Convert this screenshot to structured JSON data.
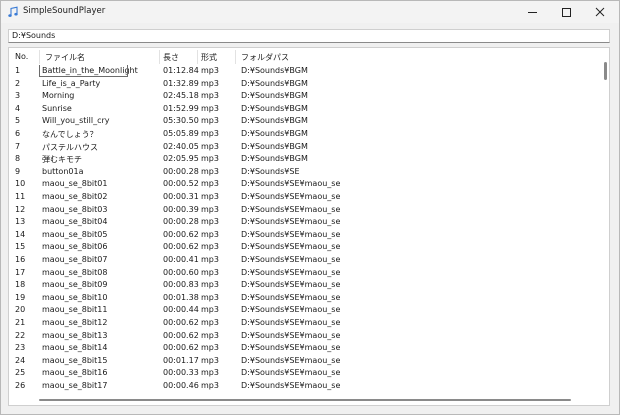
{
  "window": {
    "title": "SimpleSoundPlayer",
    "icon": "music-note-icon"
  },
  "path_bar": {
    "value": "D:¥Sounds"
  },
  "columns": [
    "No.",
    "ファイル名",
    "長さ",
    "形式",
    "フォルダパス"
  ],
  "rows": [
    {
      "no": "1",
      "name": "Battle_in_the_Moonlight",
      "length": "01:12.84",
      "format": "mp3",
      "folder": "D:¥Sounds¥BGM"
    },
    {
      "no": "2",
      "name": "Life_is_a_Party",
      "length": "01:32.89",
      "format": "mp3",
      "folder": "D:¥Sounds¥BGM"
    },
    {
      "no": "3",
      "name": "Morning",
      "length": "02:45.18",
      "format": "mp3",
      "folder": "D:¥Sounds¥BGM"
    },
    {
      "no": "4",
      "name": "Sunrise",
      "length": "01:52.99",
      "format": "mp3",
      "folder": "D:¥Sounds¥BGM"
    },
    {
      "no": "5",
      "name": "Will_you_still_cry",
      "length": "05:30.50",
      "format": "mp3",
      "folder": "D:¥Sounds¥BGM"
    },
    {
      "no": "6",
      "name": "なんでしょう？",
      "length": "05:05.89",
      "format": "mp3",
      "folder": "D:¥Sounds¥BGM"
    },
    {
      "no": "7",
      "name": "パステルハウス",
      "length": "02:40.05",
      "format": "mp3",
      "folder": "D:¥Sounds¥BGM"
    },
    {
      "no": "8",
      "name": "弾むキモチ",
      "length": "02:05.95",
      "format": "mp3",
      "folder": "D:¥Sounds¥BGM"
    },
    {
      "no": "9",
      "name": "button01a",
      "length": "00:00.28",
      "format": "mp3",
      "folder": "D:¥Sounds¥SE"
    },
    {
      "no": "10",
      "name": "maou_se_8bit01",
      "length": "00:00.52",
      "format": "mp3",
      "folder": "D:¥Sounds¥SE¥maou_se"
    },
    {
      "no": "11",
      "name": "maou_se_8bit02",
      "length": "00:00.31",
      "format": "mp3",
      "folder": "D:¥Sounds¥SE¥maou_se"
    },
    {
      "no": "12",
      "name": "maou_se_8bit03",
      "length": "00:00.39",
      "format": "mp3",
      "folder": "D:¥Sounds¥SE¥maou_se"
    },
    {
      "no": "13",
      "name": "maou_se_8bit04",
      "length": "00:00.28",
      "format": "mp3",
      "folder": "D:¥Sounds¥SE¥maou_se"
    },
    {
      "no": "14",
      "name": "maou_se_8bit05",
      "length": "00:00.62",
      "format": "mp3",
      "folder": "D:¥Sounds¥SE¥maou_se"
    },
    {
      "no": "15",
      "name": "maou_se_8bit06",
      "length": "00:00.62",
      "format": "mp3",
      "folder": "D:¥Sounds¥SE¥maou_se"
    },
    {
      "no": "16",
      "name": "maou_se_8bit07",
      "length": "00:00.41",
      "format": "mp3",
      "folder": "D:¥Sounds¥SE¥maou_se"
    },
    {
      "no": "17",
      "name": "maou_se_8bit08",
      "length": "00:00.60",
      "format": "mp3",
      "folder": "D:¥Sounds¥SE¥maou_se"
    },
    {
      "no": "18",
      "name": "maou_se_8bit09",
      "length": "00:00.83",
      "format": "mp3",
      "folder": "D:¥Sounds¥SE¥maou_se"
    },
    {
      "no": "19",
      "name": "maou_se_8bit10",
      "length": "00:01.38",
      "format": "mp3",
      "folder": "D:¥Sounds¥SE¥maou_se"
    },
    {
      "no": "20",
      "name": "maou_se_8bit11",
      "length": "00:00.44",
      "format": "mp3",
      "folder": "D:¥Sounds¥SE¥maou_se"
    },
    {
      "no": "21",
      "name": "maou_se_8bit12",
      "length": "00:00.62",
      "format": "mp3",
      "folder": "D:¥Sounds¥SE¥maou_se"
    },
    {
      "no": "22",
      "name": "maou_se_8bit13",
      "length": "00:00.62",
      "format": "mp3",
      "folder": "D:¥Sounds¥SE¥maou_se"
    },
    {
      "no": "23",
      "name": "maou_se_8bit14",
      "length": "00:00.62",
      "format": "mp3",
      "folder": "D:¥Sounds¥SE¥maou_se"
    },
    {
      "no": "24",
      "name": "maou_se_8bit15",
      "length": "00:01.17",
      "format": "mp3",
      "folder": "D:¥Sounds¥SE¥maou_se"
    },
    {
      "no": "25",
      "name": "maou_se_8bit16",
      "length": "00:00.33",
      "format": "mp3",
      "folder": "D:¥Sounds¥SE¥maou_se"
    },
    {
      "no": "26",
      "name": "maou_se_8bit17",
      "length": "00:00.46",
      "format": "mp3",
      "folder": "D:¥Sounds¥SE¥maou_se"
    }
  ],
  "colors": {
    "titlebar": "#f3f3f3",
    "list_bg": "#ffffff",
    "scroll_thumb": "#8a8a8a"
  }
}
